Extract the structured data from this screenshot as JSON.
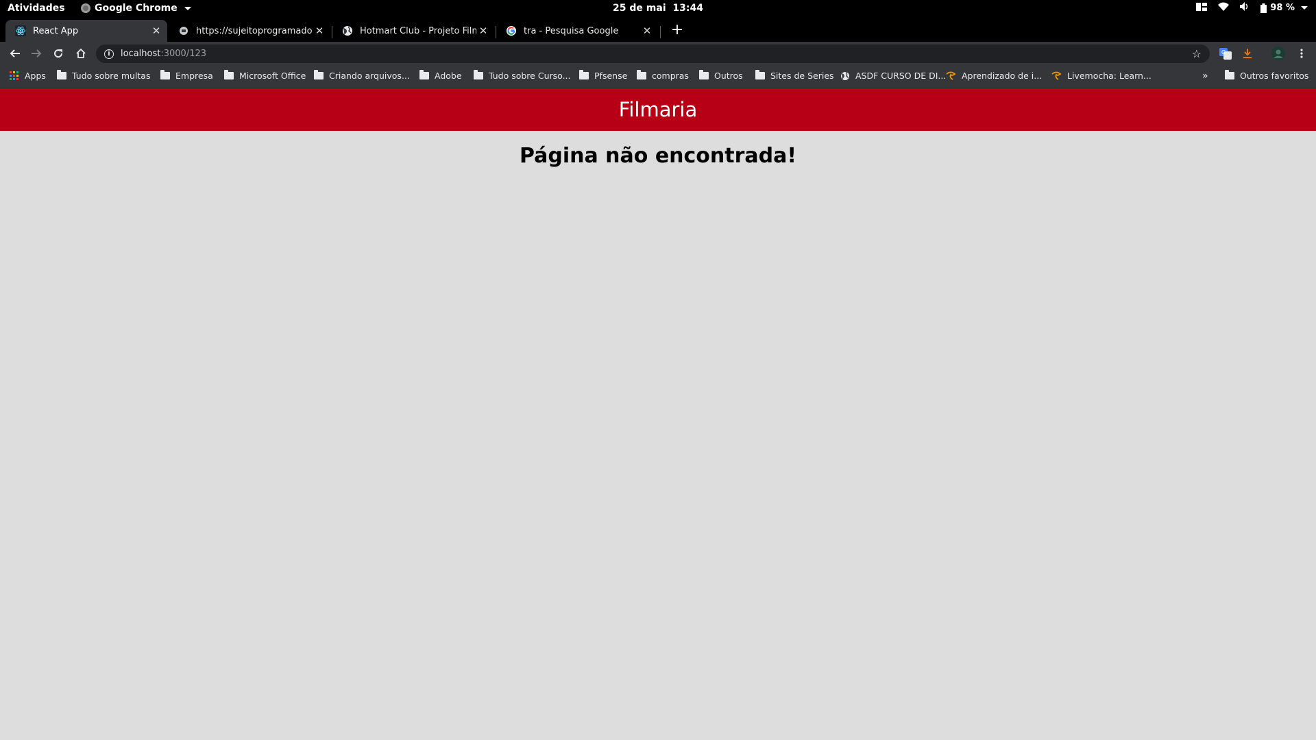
{
  "system_bar": {
    "activities": "Atividades",
    "app_menu": "Google Chrome",
    "date": "25 de mai",
    "time": "13:44",
    "battery": "98 %"
  },
  "tabs": [
    {
      "title": "React App",
      "active": true,
      "favicon": "react-icon"
    },
    {
      "title": "https://sujeitoprogramador.c",
      "active": false,
      "favicon": "page-icon"
    },
    {
      "title": "Hotmart Club - Projeto Filmes",
      "active": false,
      "favicon": "globe-icon"
    },
    {
      "title": "tra - Pesquisa Google",
      "active": false,
      "favicon": "google-icon"
    }
  ],
  "address_bar": {
    "host": "localhost",
    "path": ":3000/123"
  },
  "bookmarks": [
    {
      "label": "Apps",
      "icon": "apps-grid-icon"
    },
    {
      "label": "Tudo sobre multas",
      "icon": "folder-icon"
    },
    {
      "label": "Empresa",
      "icon": "folder-icon"
    },
    {
      "label": "Microsoft Office",
      "icon": "folder-icon"
    },
    {
      "label": "Criando arquivos...",
      "icon": "folder-icon"
    },
    {
      "label": "Adobe",
      "icon": "folder-icon"
    },
    {
      "label": "Tudo sobre Curso...",
      "icon": "folder-icon"
    },
    {
      "label": "Pfsense",
      "icon": "folder-icon"
    },
    {
      "label": "compras",
      "icon": "folder-icon"
    },
    {
      "label": "Outros",
      "icon": "folder-icon"
    },
    {
      "label": "Sites de Series",
      "icon": "folder-icon"
    },
    {
      "label": "ASDF CURSO DE DI...",
      "icon": "globe-icon"
    },
    {
      "label": "Aprendizado de i...",
      "icon": "livemocha-icon"
    },
    {
      "label": "Livemocha: Learn...",
      "icon": "livemocha-icon"
    },
    {
      "label": "Outros favoritos",
      "icon": "folder-icon"
    }
  ],
  "page": {
    "brand": "Filmaria",
    "message": "Página não encontrada!",
    "brand_color": "#b70016",
    "background_color": "#dddddd"
  }
}
